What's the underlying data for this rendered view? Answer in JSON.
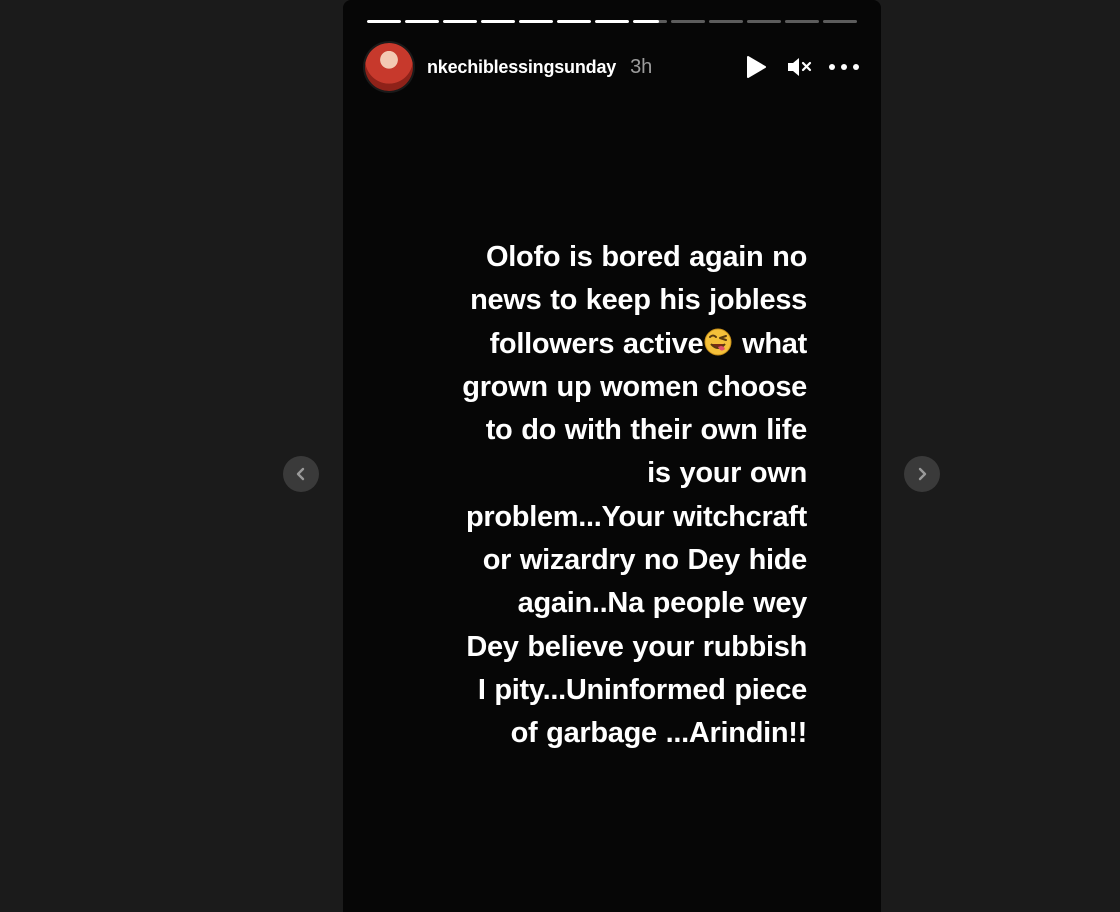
{
  "story": {
    "progress": {
      "segments_total": 13,
      "segments_complete": 7,
      "current_segment_fraction": 0.75
    },
    "header": {
      "username": "nkechiblessingsunday",
      "time_ago": "3h",
      "avatar_icon": "avatar",
      "play_icon": "play-icon",
      "mute_icon": "muted-speaker-icon",
      "more_icon": "more-options-icon"
    },
    "text_lines": [
      "Olofo is bored again no",
      "news to keep his jobless",
      "followers active",
      "grown up women choose",
      "to do with their own life",
      "is your own",
      "problem...Your witchcraft",
      "or wizardry no Dey hide",
      "again..Na people wey",
      "Dey believe your rubbish",
      "I pity...Uninformed piece",
      "of garbage ...Arindin!!"
    ],
    "line3_suffix": " what",
    "emoji": "winking-tongue-emoji"
  },
  "navigation": {
    "prev_icon": "chevron-left-icon",
    "next_icon": "chevron-right-icon"
  }
}
